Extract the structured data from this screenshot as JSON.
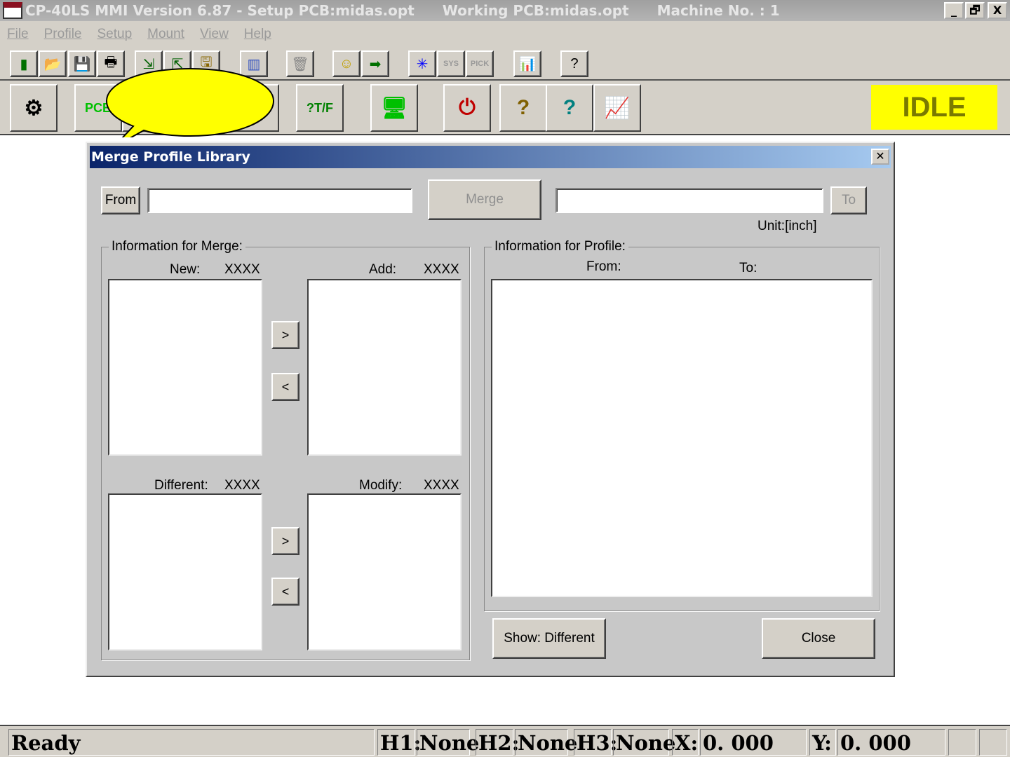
{
  "titlebar": {
    "title": "CP-40LS MMI Version 6.87 - Setup PCB:midas.opt",
    "working": "Working PCB:midas.opt",
    "machine": "Machine No. : 1",
    "minimize": "_",
    "restore": "🗗",
    "close": "X"
  },
  "menu": [
    "File",
    "Profile",
    "Setup",
    "Mount",
    "View",
    "Help"
  ],
  "toolbar1": [
    {
      "icon": "new-file-icon",
      "glyph": "▮",
      "color": "#007000"
    },
    {
      "icon": "open-folder-icon",
      "glyph": "📂",
      "color": "#007000"
    },
    {
      "icon": "save-icon",
      "glyph": "💾",
      "color": "#006000"
    },
    {
      "icon": "print-icon",
      "glyph": "🖶",
      "color": "#000"
    },
    {
      "icon": "import-icon",
      "glyph": "⇲",
      "color": "#006000"
    },
    {
      "icon": "export-icon",
      "glyph": "⇱",
      "color": "#006000"
    },
    {
      "icon": "save-as-icon",
      "glyph": "🖫",
      "color": "#886600"
    },
    {
      "icon": "library-icon",
      "glyph": "▥",
      "color": "#3050c0"
    },
    {
      "icon": "delete-icon",
      "glyph": "🗑",
      "color": "#888"
    },
    {
      "icon": "smiley-icon",
      "glyph": "☺",
      "color": "#c0a000"
    },
    {
      "icon": "exit-icon",
      "glyph": "➡",
      "color": "#007000"
    },
    {
      "icon": "origin-icon",
      "glyph": "✳",
      "color": "#0000ff"
    },
    {
      "icon": "sys-icon",
      "glyph": "SYS",
      "color": "#999"
    },
    {
      "icon": "pick-icon",
      "glyph": "PICK",
      "color": "#999"
    },
    {
      "icon": "chart-icon",
      "glyph": "📊",
      "color": "#c00"
    },
    {
      "icon": "help-icon",
      "glyph": "?",
      "color": "#000"
    }
  ],
  "toolbar2": [
    {
      "icon": "component-icon",
      "glyph": "⚙",
      "color": "#000"
    },
    {
      "icon": "pcb-icon",
      "glyph": "PCB",
      "color": "#00c000"
    },
    {
      "icon": "hidden-icon",
      "glyph": "",
      "color": "#000"
    },
    {
      "icon": "tf-keyboard-icon",
      "glyph": "?T/F",
      "color": "#008000"
    },
    {
      "icon": "monitor-icon",
      "glyph": "🖥",
      "color": "#00c000"
    },
    {
      "icon": "on-off-icon",
      "glyph": "⏻",
      "color": "#c00000"
    },
    {
      "icon": "feeder-help-icon",
      "glyph": "?",
      "color": "#806000"
    },
    {
      "icon": "nozzle-help-icon",
      "glyph": "?",
      "color": "#008080"
    },
    {
      "icon": "stats-help-icon",
      "glyph": "📈",
      "color": "#c00060"
    }
  ],
  "status_indicator": {
    "text": "IDLE",
    "color": "#ffff00"
  },
  "dialog": {
    "title": "Merge Profile Library",
    "close": "✕",
    "from_button": "From",
    "from_value": "",
    "merge_button": "Merge",
    "to_value": "",
    "to_button": "To",
    "unit": "Unit:[inch]",
    "merge_group": "Information for Merge:",
    "new_label": "New:",
    "new_count": "XXXX",
    "add_label": "Add:",
    "add_count": "XXXX",
    "different_label": "Different:",
    "different_count": "XXXX",
    "modify_label": "Modify:",
    "modify_count": "XXXX",
    "right": ">",
    "left": "<",
    "profile_group": "Information for Profile:",
    "from_col": "From:",
    "to_col": "To:",
    "show_button": "Show: Different",
    "close_button": "Close"
  },
  "statusbar": {
    "text": "Ready",
    "h1_label": "H1:",
    "h1": "None",
    "h2_label": "H2:",
    "h2": "None",
    "h3_label": "H3:",
    "h3": "None",
    "x_label": "X:",
    "x": "0. 000",
    "y_label": "Y:",
    "y": "0. 000"
  }
}
